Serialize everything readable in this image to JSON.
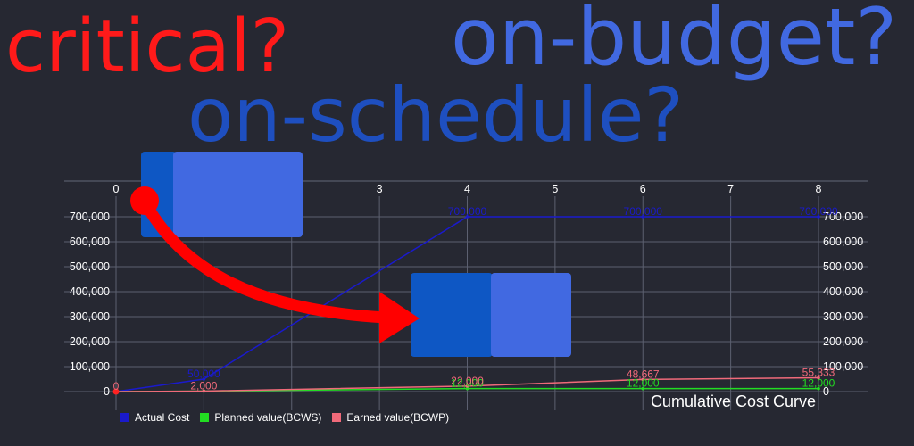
{
  "headlines": {
    "critical": "critical?",
    "budget": "on-budget?",
    "schedule": "on-schedule?"
  },
  "colors": {
    "critical": "#ff1a1a",
    "budget": "#4169e1",
    "schedule": "#1e4fc0",
    "arrow": "#ff0000"
  },
  "chart_data": {
    "type": "line",
    "title": "Cumulative Cost Curve",
    "x": [
      0,
      1,
      2,
      3,
      4,
      5,
      6,
      7,
      8
    ],
    "x_ticks": [
      "0",
      "3",
      "4",
      "5",
      "6",
      "7",
      "8"
    ],
    "x_tick_values": [
      0,
      3,
      4,
      5,
      6,
      7,
      8
    ],
    "xlim": [
      0,
      8
    ],
    "ylim": [
      0,
      700000
    ],
    "y_ticks": [
      "0",
      "100,000",
      "200,000",
      "300,000",
      "400,000",
      "500,000",
      "600,000",
      "700,000"
    ],
    "y_tick_values": [
      0,
      100000,
      200000,
      300000,
      400000,
      500000,
      600000,
      700000
    ],
    "grid": true,
    "legend_position": "bottom-left",
    "series": [
      {
        "name": "Actual Cost",
        "color": "#1a1acc",
        "points": [
          [
            0,
            0
          ],
          [
            1,
            50000
          ],
          [
            4,
            700000
          ],
          [
            6,
            700000
          ],
          [
            8,
            700000
          ]
        ],
        "labels": [
          {
            "x": 1,
            "y": 50000,
            "text": "50,000"
          },
          {
            "x": 4,
            "y": 700000,
            "text": "700,000"
          },
          {
            "x": 6,
            "y": 700000,
            "text": "700,000"
          },
          {
            "x": 8,
            "y": 700000,
            "text": "700,000"
          }
        ]
      },
      {
        "name": "Planned value(BCWS)",
        "color": "#22dd22",
        "points": [
          [
            0,
            0
          ],
          [
            1,
            2000
          ],
          [
            4,
            12000
          ],
          [
            6,
            12000
          ],
          [
            8,
            12000
          ]
        ],
        "labels": [
          {
            "x": 4,
            "y": 12000,
            "text": "12,000"
          },
          {
            "x": 6,
            "y": 12000,
            "text": "12,000"
          },
          {
            "x": 8,
            "y": 12000,
            "text": "12,000"
          }
        ]
      },
      {
        "name": "Earned value(BCWP)",
        "color": "#f06a7a",
        "points": [
          [
            0,
            0
          ],
          [
            1,
            2000
          ],
          [
            4,
            22000
          ],
          [
            6,
            48667
          ],
          [
            8,
            55333
          ]
        ],
        "labels": [
          {
            "x": 0,
            "y": 0,
            "text": "0"
          },
          {
            "x": 1,
            "y": 2000,
            "text": "2,000"
          },
          {
            "x": 4,
            "y": 22000,
            "text": "22,000"
          },
          {
            "x": 6,
            "y": 48667,
            "text": "48,667"
          },
          {
            "x": 8,
            "y": 55333,
            "text": "55,333"
          }
        ]
      }
    ]
  }
}
